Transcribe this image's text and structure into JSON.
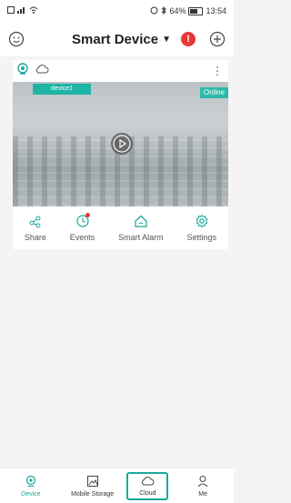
{
  "status_bar": {
    "time": "13:54",
    "battery": "64%"
  },
  "header": {
    "title": "Smart Device",
    "alert_count": "!"
  },
  "device_card": {
    "device_name": "device1",
    "status": "Online",
    "actions": [
      {
        "label": "Share",
        "icon": "share-icon"
      },
      {
        "label": "Events",
        "icon": "clock-icon"
      },
      {
        "label": "Smart Alarm",
        "icon": "home-alarm-icon"
      },
      {
        "label": "Settings",
        "icon": "gear-icon"
      }
    ]
  },
  "tabs": [
    {
      "label": "Device",
      "icon": "camera-icon"
    },
    {
      "label": "Mobile Storage",
      "icon": "image-icon"
    },
    {
      "label": "Cloud",
      "icon": "cloud-icon"
    },
    {
      "label": "Me",
      "icon": "person-icon"
    }
  ],
  "colors": {
    "accent": "#1ba89a",
    "alert": "#e53935",
    "online": "#2fb9a8"
  }
}
